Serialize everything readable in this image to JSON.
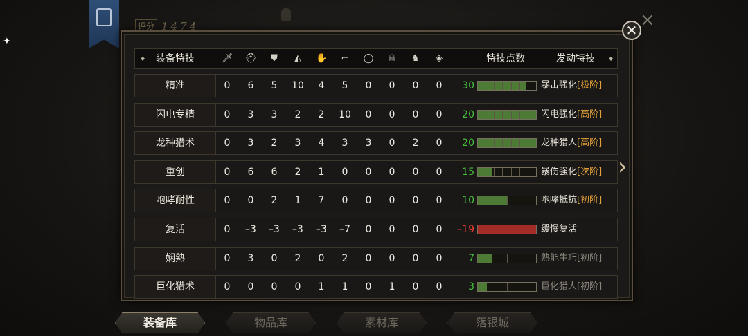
{
  "background": {
    "score_label": "评分",
    "score_value": "1474"
  },
  "header": {
    "skill_label": "装备特技",
    "slot_icons": [
      "sword-icon",
      "helmet-icon",
      "chest-armor-icon",
      "shoulder-icon",
      "gloves-icon",
      "boots-icon",
      "ring-icon",
      "beast-icon",
      "mount-icon",
      "gem-icon"
    ],
    "points_label": "特技点数",
    "trigger_label": "发动特技"
  },
  "rows": [
    {
      "name": "精准",
      "values": [
        "0",
        "6",
        "5",
        "10",
        "4",
        "5",
        "0",
        "0",
        "0",
        "0"
      ],
      "points": "30",
      "fill": 0.82,
      "type": "green",
      "effect": "暴击强化",
      "tier": "[极阶]",
      "dim": false
    },
    {
      "name": "闪电专精",
      "values": [
        "0",
        "3",
        "3",
        "2",
        "2",
        "10",
        "0",
        "0",
        "0",
        "0"
      ],
      "points": "20",
      "fill": 1.0,
      "type": "green",
      "effect": "闪电强化",
      "tier": "[高阶]",
      "dim": false
    },
    {
      "name": "龙种猎术",
      "values": [
        "0",
        "3",
        "2",
        "3",
        "4",
        "3",
        "3",
        "0",
        "2",
        "0"
      ],
      "points": "20",
      "fill": 1.0,
      "type": "green",
      "effect": "龙种猎人",
      "tier": "[高阶]",
      "dim": false
    },
    {
      "name": "重创",
      "values": [
        "0",
        "6",
        "6",
        "2",
        "1",
        "0",
        "0",
        "0",
        "0",
        "0"
      ],
      "points": "15",
      "fill": 0.25,
      "type": "green",
      "effect": "暴伤强化",
      "tier": "[次阶]",
      "dim": false
    },
    {
      "name": "咆哮耐性",
      "values": [
        "0",
        "0",
        "2",
        "1",
        "7",
        "0",
        "0",
        "0",
        "0",
        "0"
      ],
      "points": "10",
      "fill": 0.5,
      "type": "green",
      "effect": "咆哮抵抗",
      "tier": "[初阶]",
      "dim": false
    },
    {
      "name": "复活",
      "values": [
        "0",
        "–3",
        "–3",
        "–3",
        "–3",
        "–7",
        "0",
        "0",
        "0",
        "0"
      ],
      "points": "–19",
      "fill": 1.0,
      "type": "red",
      "effect": "缓慢复活",
      "tier": "",
      "dim": false
    },
    {
      "name": "娴熟",
      "values": [
        "0",
        "3",
        "0",
        "2",
        "0",
        "2",
        "0",
        "0",
        "0",
        "0"
      ],
      "points": "7",
      "fill": 0.25,
      "type": "green",
      "effect": "熟能生巧",
      "tier": "[初阶]",
      "dim": true
    },
    {
      "name": "巨化猎术",
      "values": [
        "0",
        "0",
        "0",
        "0",
        "1",
        "1",
        "0",
        "1",
        "0",
        "0"
      ],
      "points": "3",
      "fill": 0.15,
      "type": "green",
      "effect": "巨化猎人",
      "tier": "[初阶]",
      "dim": true
    }
  ],
  "bottom_tabs": [
    {
      "label": "装备库",
      "active": true
    },
    {
      "label": "物品库",
      "active": false
    },
    {
      "label": "素材库",
      "active": false
    },
    {
      "label": "落银城",
      "active": false
    }
  ],
  "colors": {
    "points_green": "#45c23d",
    "points_red": "#e03a36",
    "bar_green": "#4d7a35",
    "bar_red": "#a32c27",
    "tier_orange": "#e2a038"
  }
}
